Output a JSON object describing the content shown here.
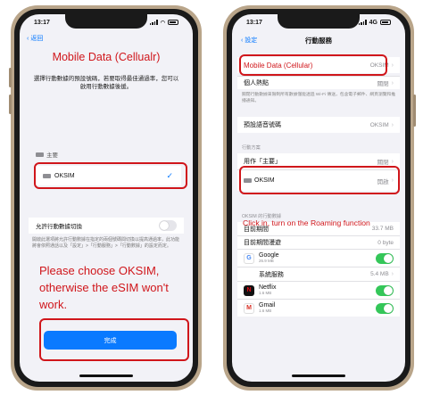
{
  "left_phone": {
    "status_time": "13:17",
    "back_label": "返回",
    "annotation_title": "Mobile Data (Cellualr)",
    "description": "選擇行動數據的預設號碼，若要取得最佳通過率，您可以啟用行動數據後援。",
    "primary_label": "主要",
    "sim_chip": "主要",
    "oksim_label": "OKSIM",
    "allow_switch_label": "允許行動數據切換",
    "footnote": "開啟此選項將允許行動數據在指定的兩個號碼間切換以提高通過率，此功能將會依照通話以及「設定」>「行動服務」>「行動數據」的設定而定。",
    "annotation_warning": "Please choose OKSIM, otherwise the eSIM won't work.",
    "done_label": "完成"
  },
  "right_phone": {
    "status_time": "13:17",
    "network": "4G",
    "back_label": "設定",
    "title": "行動服務",
    "rows": {
      "cellular_data": {
        "label": "Mobile Data (Cellular)",
        "value": "OKSIM"
      },
      "hotspot": {
        "label": "個人熱點",
        "value": "關閉"
      },
      "hotspot_note": "關閉行動數據來限制所有數據僅能透過 Wi-Fi 傳送，包含電子郵件、網頁瀏覽和推播通知。",
      "default_voice": {
        "label": "預設語音號碼",
        "value": "OKSIM"
      },
      "plans_header": "行動方案",
      "primary_plan": {
        "label": "用作「主要」",
        "value": "關閉"
      },
      "oksim_plan": {
        "label": "OKSIM",
        "value": "開啟"
      },
      "usage_header": "OKSIM 的行動數據",
      "current_period": {
        "label": "目前期間",
        "value": "33.7 MB"
      },
      "current_roaming": {
        "label": "目前期間漫遊",
        "value": "0 byte"
      },
      "google": {
        "label": "Google",
        "size": "26.9 MB"
      },
      "system_services": {
        "label": "系統服務",
        "value": "5.4 MB"
      },
      "netflix": {
        "label": "Netflix",
        "size": "1.6 MB"
      },
      "gmail": {
        "label": "Gmail",
        "size": "1.6 MB"
      }
    },
    "annotation": "Click in, turn on the Roaming function"
  },
  "colors": {
    "accent_red": "#d0161b",
    "ios_blue": "#0a7aff",
    "ios_green": "#34c759"
  }
}
